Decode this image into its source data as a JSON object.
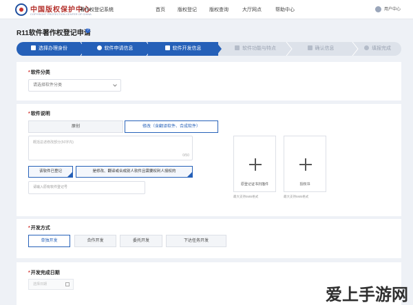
{
  "header": {
    "logo_text": "中国版权保护中心",
    "logo_subtext": "COPYRIGHT PROTECTION CENTER OF CHINA",
    "system_name": "著作权登记系统",
    "nav": [
      "首页",
      "版权登记",
      "版权查询",
      "大厅网点",
      "帮助中心"
    ],
    "user_label": "用户中心"
  },
  "page": {
    "title": "R11软件著作权登记申请",
    "help_glyph": "?"
  },
  "steps": [
    {
      "label": "选择办理身份",
      "state": "done"
    },
    {
      "label": "软件申请信息",
      "state": "done"
    },
    {
      "label": "软件开发信息",
      "state": "current"
    },
    {
      "label": "软件功能与特点",
      "state": "todo"
    },
    {
      "label": "确认信息",
      "state": "todo"
    },
    {
      "label": "填报完成",
      "state": "todo"
    }
  ],
  "category": {
    "label": "软件分类",
    "required_mark": "*",
    "select_placeholder": "请选择软件分类"
  },
  "description": {
    "label": "软件说明",
    "required_mark": "*",
    "options": [
      "原创",
      "修改（含翻译软件、合成软件）"
    ],
    "selected_index": 1,
    "textarea_placeholder": "概括总述修改部分(50字内)",
    "counter": "0/50",
    "btn_registered": "该软件已登记",
    "btn_authorized": "是修改、翻译或合成别人软件且需要权利人授权的",
    "reg_number_placeholder": "请输入原有软件登记号",
    "uploads": [
      {
        "label": "原登记证书扫描件",
        "note": "最大支持5MB格式"
      },
      {
        "label": "授权书",
        "note": "最大支持5MB格式"
      }
    ]
  },
  "dev_method": {
    "label": "开发方式",
    "required_mark": "*",
    "options": [
      "单独开发",
      "合作开发",
      "委托开发",
      "下达任务开发"
    ],
    "selected_index": 0
  },
  "completion_date": {
    "label": "开发完成日期",
    "required_mark": "*",
    "placeholder": "选择日期"
  },
  "watermark": "爱上手游网",
  "colors": {
    "primary": "#2560b8",
    "required": "#d0312d",
    "brand_red": "#b4302b",
    "background": "#eef1f6"
  }
}
